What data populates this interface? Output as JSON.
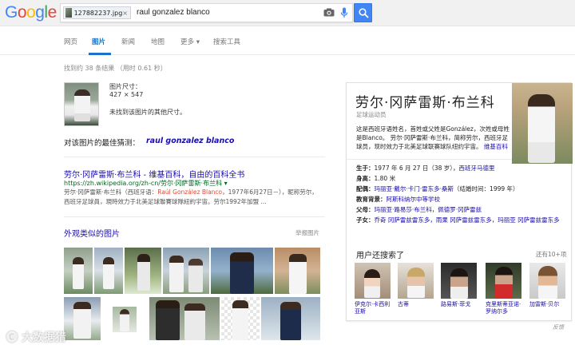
{
  "header": {
    "logo": [
      "G",
      "o",
      "o",
      "g",
      "l",
      "e"
    ],
    "logo_colors": [
      "#4285f4",
      "#ea4335",
      "#fbbc05",
      "#4285f4",
      "#34a853",
      "#ea4335"
    ],
    "image_chip": "127882237.jpg",
    "chip_close": "×",
    "query": "raul gonzalez blanco"
  },
  "tabs": {
    "web": "网页",
    "images": "图片",
    "news": "新闻",
    "maps": "地图",
    "more": "更多 ▾",
    "tools": "搜索工具"
  },
  "stats": "找到约 38 条结果 （用时 0.61 秒）",
  "image_info": {
    "size_label": "图片尺寸：",
    "size_value": "427 × 547",
    "not_found": "未找到该图片的其他尺寸。"
  },
  "guess": {
    "label": "对该图片的最佳猜测：",
    "value": "raul gonzalez blanco"
  },
  "result": {
    "title": "劳尔·冈萨雷斯·布兰科 - 维基百科，自由的百科全书",
    "url": "https://zh.wikipedia.org/zh-cn/劳尔·冈萨雷斯·布兰科 ▾",
    "snippet_pre": "劳尔·冈萨雷斯·布兰科（西班牙语：",
    "snippet_red": "Raúl González Blanco",
    "snippet_post": "，1977年6月27日－），昵称劳尔，西班牙足球員，現時效力于北美足球聯賽球隊紐約宇宙。劳尔1992年加盟 ..."
  },
  "similar": {
    "title": "外观类似的图片",
    "report": "举报图片"
  },
  "knowledge_panel": {
    "title": "劳尔·冈萨雷斯·布兰科",
    "subtitle": "足球运动员",
    "desc_pre": "这是西班牙语姓名，首姓或父姓是González，次姓或母姓是Blanco。 劳尔·冈萨雷斯·布兰科，简称劳尔，西班牙足球员，现时效力于北美足球联赛球队纽约宇宙。",
    "desc_link": "维基百科",
    "born_label": "生于：",
    "born_value": "1977 年 6 月 27 日（38 岁），",
    "born_link": "西班牙马德里",
    "height_label": "身高：",
    "height_value": "1.80 米",
    "spouse_label": "配偶：",
    "spouse_link": "玛丽亚·戴尔·卡门·雷东多·桑斯",
    "spouse_value": "（结婚时间：1999 年）",
    "edu_label": "教育背景：",
    "edu_link": "阿斯科纳尔中等学校",
    "parents_label": "父母：",
    "parents_link1": "玛丽亚·路易莎·布兰科",
    "parents_link2": "佩德罗·冈萨雷兹",
    "children_label": "子女：",
    "children_text": "乔奇 冈萨雷兹雷东多，雨果 冈萨雷兹雷东多，玛丽亚 冈萨雷兹雷东多",
    "also_title": "用户还搜索了",
    "also_more": "还有10+项",
    "also": [
      {
        "name": "伊克尔·卡西利亚斯"
      },
      {
        "name": "古蒂"
      },
      {
        "name": "路易斯·菲戈"
      },
      {
        "name": "克里斯蒂亚诺·罗纳尔多"
      },
      {
        "name": "加雷斯·贝尔"
      }
    ],
    "feedback": "反馈"
  },
  "watermark": "🅒 大数据猎"
}
